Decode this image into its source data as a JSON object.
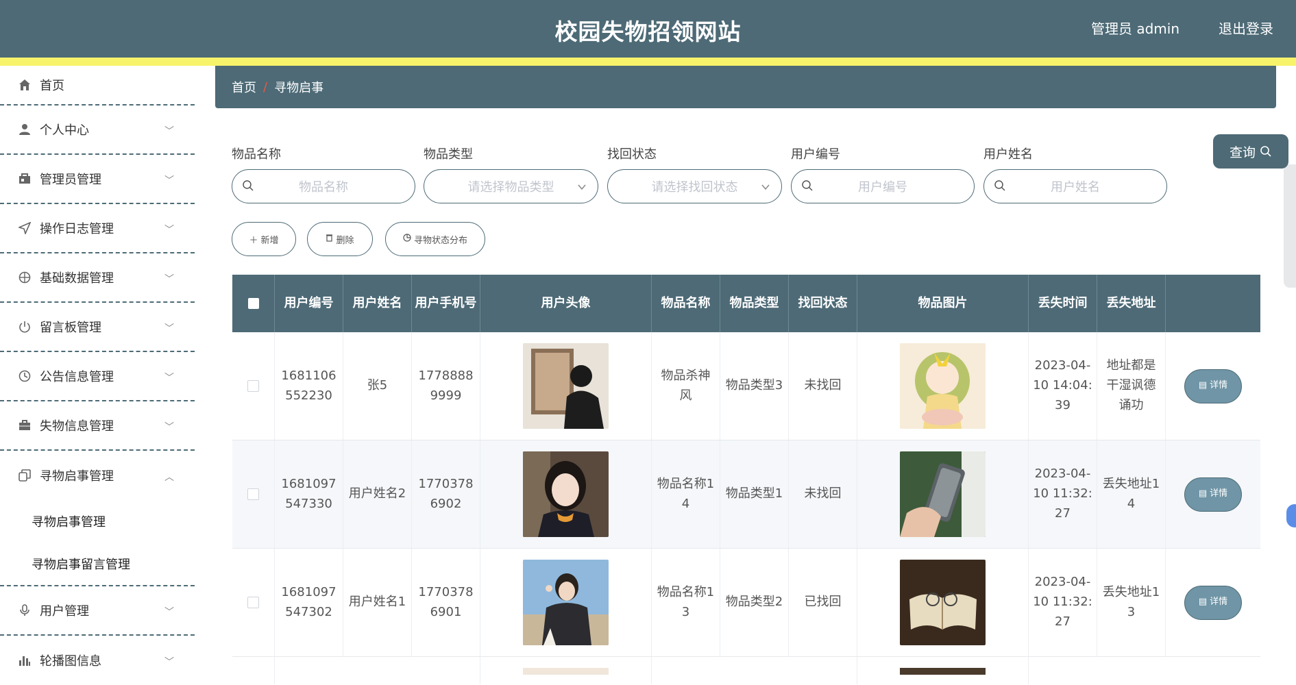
{
  "header": {
    "title": "校园失物招领网站",
    "user": "管理员 admin",
    "logout": "退出登录"
  },
  "sidebar": {
    "items": [
      {
        "label": "首页",
        "icon": "home-icon"
      },
      {
        "label": "个人中心",
        "icon": "user-icon"
      },
      {
        "label": "管理员管理",
        "icon": "badge-icon"
      },
      {
        "label": "操作日志管理",
        "icon": "send-icon"
      },
      {
        "label": "基础数据管理",
        "icon": "crosshair-icon"
      },
      {
        "label": "留言板管理",
        "icon": "power-icon"
      },
      {
        "label": "公告信息管理",
        "icon": "clock-icon"
      },
      {
        "label": "失物信息管理",
        "icon": "briefcase-icon"
      },
      {
        "label": "寻物启事管理",
        "icon": "copy-icon"
      },
      {
        "label": "用户管理",
        "icon": "mic-icon"
      },
      {
        "label": "轮播图信息",
        "icon": "bar-chart-icon"
      }
    ],
    "submenu": [
      "寻物启事管理",
      "寻物启事留言管理"
    ]
  },
  "breadcrumb": {
    "home": "首页",
    "sep": "/",
    "current": "寻物启事"
  },
  "filters": {
    "item_name": {
      "label": "物品名称",
      "placeholder": "物品名称"
    },
    "item_type": {
      "label": "物品类型",
      "placeholder": "请选择物品类型"
    },
    "status": {
      "label": "找回状态",
      "placeholder": "请选择找回状态"
    },
    "user_no": {
      "label": "用户编号",
      "placeholder": "用户编号"
    },
    "user_name": {
      "label": "用户姓名",
      "placeholder": "用户姓名"
    },
    "query": "查询"
  },
  "actions": {
    "add": "新增",
    "delete": "删除",
    "distribution": "寻物状态分布"
  },
  "table": {
    "headers": [
      "用户编号",
      "用户姓名",
      "用户手机号",
      "用户头像",
      "物品名称",
      "物品类型",
      "找回状态",
      "物品图片",
      "丢失时间",
      "丢失地址"
    ],
    "detail_label": "详情",
    "rows": [
      {
        "user_no": "1681106552230",
        "user_name": "张5",
        "phone": "17788889999",
        "item_name": "物品杀神风",
        "item_type": "物品类型3",
        "status": "未找回",
        "lost_time": "2023-04-10 14:04:39",
        "lost_addr": "地址都是干湿讽德诵功"
      },
      {
        "user_no": "1681097547330",
        "user_name": "用户姓名2",
        "phone": "17703786902",
        "item_name": "物品名称14",
        "item_type": "物品类型1",
        "status": "未找回",
        "lost_time": "2023-04-10 11:32:27",
        "lost_addr": "丢失地址14"
      },
      {
        "user_no": "1681097547302",
        "user_name": "用户姓名1",
        "phone": "17703786901",
        "item_name": "物品名称13",
        "item_type": "物品类型2",
        "status": "已找回",
        "lost_time": "2023-04-10 11:32:27",
        "lost_addr": "丢失地址13"
      }
    ]
  },
  "colors": {
    "primary": "#4d6a76",
    "accent_bar": "#f7f36a",
    "breadcrumb_sep": "#e85a3f",
    "detail_btn": "#6f95a6"
  }
}
